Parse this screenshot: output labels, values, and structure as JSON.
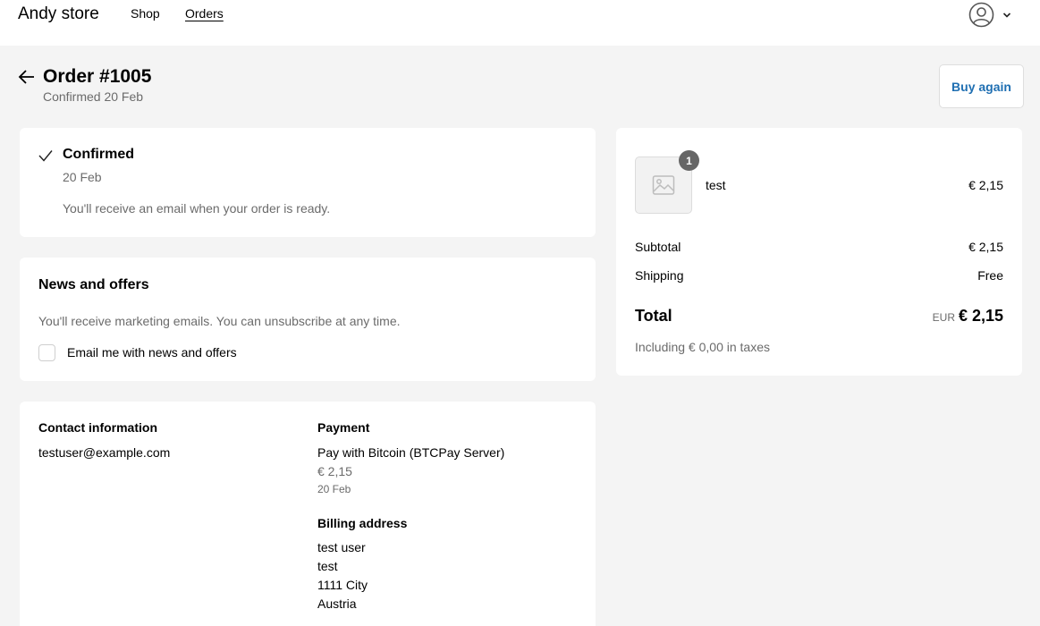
{
  "header": {
    "brand": "Andy store",
    "nav": {
      "shop": "Shop",
      "orders": "Orders"
    }
  },
  "order": {
    "title": "Order #1005",
    "subtitle": "Confirmed 20 Feb",
    "buy_again": "Buy again"
  },
  "status": {
    "title": "Confirmed",
    "date": "20 Feb",
    "message": "You'll receive an email when your order is ready."
  },
  "news": {
    "title": "News and offers",
    "message": "You'll receive marketing emails. You can unsubscribe at any time.",
    "checkbox_label": "Email me with news and offers"
  },
  "contact": {
    "heading": "Contact information",
    "email": "testuser@example.com"
  },
  "payment": {
    "heading": "Payment",
    "method": "Pay with Bitcoin (BTCPay Server)",
    "amount": "€ 2,15",
    "date": "20 Feb"
  },
  "billing": {
    "heading": "Billing address",
    "lines": [
      "test user",
      "test",
      "1111 City",
      "Austria"
    ]
  },
  "summary": {
    "item": {
      "name": "test",
      "quantity": "1",
      "price": "€ 2,15"
    },
    "subtotal_label": "Subtotal",
    "subtotal_value": "€ 2,15",
    "shipping_label": "Shipping",
    "shipping_value": "Free",
    "total_label": "Total",
    "total_currency": "EUR",
    "total_value": "€ 2,15",
    "tax_note": "Including € 0,00 in taxes"
  },
  "colors": {
    "accent": "#1f6fb2",
    "background": "#f4f4f4",
    "muted": "#6b6b6b"
  }
}
